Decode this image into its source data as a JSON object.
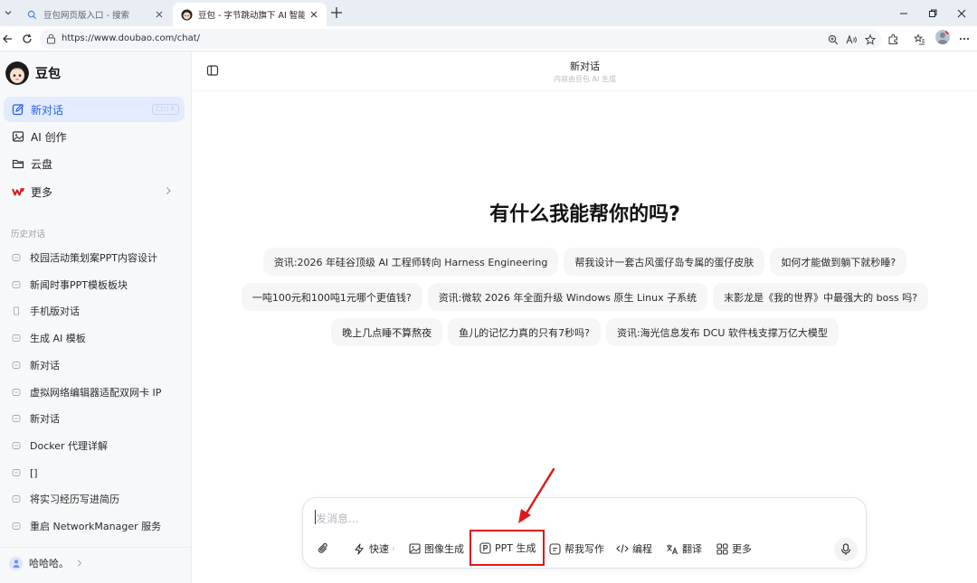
{
  "browser": {
    "tabs": [
      {
        "title": "豆包网页版入口 - 搜索",
        "active": false
      },
      {
        "title": "豆包 - 字节跳动旗下 AI 智能助手",
        "active": true
      }
    ],
    "url": "https://www.doubao.com/chat/"
  },
  "sidebar": {
    "app_name": "豆包",
    "nav": [
      {
        "label": "新对话",
        "icon": "new-chat-icon",
        "hotkey": "Ctrl K",
        "active": true
      },
      {
        "label": "AI 创作",
        "icon": "image-icon"
      },
      {
        "label": "云盘",
        "icon": "folder-icon"
      },
      {
        "label": "更多",
        "icon": "wps-icon"
      }
    ],
    "history_label": "历史对话",
    "history": [
      "校园活动策划案PPT内容设计",
      "新闻时事PPT模板板块",
      "手机版对话",
      "生成 AI 模板",
      "新对话",
      "虚拟网络编辑器适配双网卡 IP",
      "新对话",
      "Docker 代理详解",
      "[]",
      "将实习经历写进简历",
      "重启 NetworkManager 服务"
    ],
    "user_name": "哈哈哈。"
  },
  "main": {
    "header_title": "新对话",
    "header_subtitle": "内容由豆包 AI 生成",
    "hero": "有什么我能帮你的吗?",
    "suggestions": [
      [
        "资讯:2026 年硅谷顶级 AI 工程师转向 Harness Engineering",
        "帮我设计一套古风蛋仔岛专属的蛋仔皮肤",
        "如何才能做到躺下就秒睡?"
      ],
      [
        "一吨100元和100吨1元哪个更值钱?",
        "资讯:微软 2026 年全面升级 Windows 原生 Linux 子系统",
        "末影龙是《我的世界》中最强大的 boss 吗?"
      ],
      [
        "晚上几点睡不算熬夜",
        "鱼儿的记忆力真的只有7秒吗?",
        "资讯:海光信息发布 DCU 软件栈支撑万亿大模型"
      ]
    ],
    "composer": {
      "placeholder": "发消息...",
      "tools": [
        {
          "label": "快速",
          "icon": "lightning-icon"
        },
        {
          "label": "图像生成",
          "icon": "image-icon"
        },
        {
          "label": "PPT 生成",
          "icon": "ppt-icon",
          "highlighted": true
        },
        {
          "label": "帮我写作",
          "icon": "write-icon"
        },
        {
          "label": "编程",
          "icon": "code-icon"
        },
        {
          "label": "翻译",
          "icon": "translate-icon"
        },
        {
          "label": "更多",
          "icon": "grid-icon"
        }
      ]
    }
  },
  "colors": {
    "accent": "#2a5fe8",
    "active_nav_bg": "#e3ecfe",
    "annotation_red": "#e0161a",
    "sidebar_bg": "#f7f8fa"
  }
}
